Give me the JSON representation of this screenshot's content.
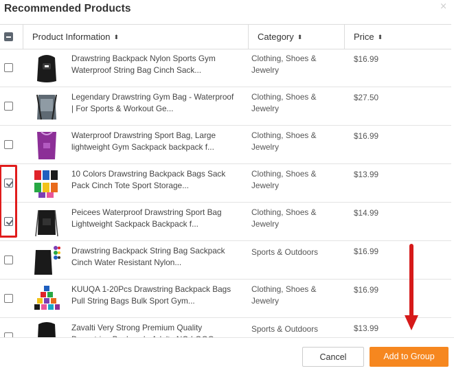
{
  "modal": {
    "title": "Recommended Products",
    "close_glyph": "×"
  },
  "table": {
    "columns": [
      {
        "label": "Product Information",
        "sort_glyph": "⬍"
      },
      {
        "label": "Category",
        "sort_glyph": "⬍"
      },
      {
        "label": "Price",
        "sort_glyph": "⬍"
      }
    ],
    "rows": [
      {
        "name": "Drawstring Backpack Nylon Sports Gym Waterproof String Bag Cinch Sack...",
        "category": "Clothing, Shoes & Jewelry",
        "price": "$16.99",
        "checked": false,
        "thumb": "black-backpack-icon"
      },
      {
        "name": "Legendary Drawstring Gym Bag - Waterproof | For Sports & Workout Ge...",
        "category": "Clothing, Shoes & Jewelry",
        "price": "$27.50",
        "checked": false,
        "thumb": "grey-gym-bag-icon"
      },
      {
        "name": "Waterproof Drawstring Sport Bag, Large lightweight Gym Sackpack backpack f...",
        "category": "Clothing, Shoes & Jewelry",
        "price": "$16.99",
        "checked": false,
        "thumb": "purple-drawstring-bag-icon"
      },
      {
        "name": "10 Colors Drawstring Backpack Bags Sack Pack Cinch Tote Sport Storage...",
        "category": "Clothing, Shoes & Jewelry",
        "price": "$13.99",
        "checked": true,
        "thumb": "multicolor-bags-icon"
      },
      {
        "name": "Peicees Waterproof Drawstring Sport Bag Lightweight Sackpack Backpack f...",
        "category": "Clothing, Shoes & Jewelry",
        "price": "$14.99",
        "checked": true,
        "thumb": "black-sackpack-icon"
      },
      {
        "name": "Drawstring Backpack String Bag Sackpack Cinch Water Resistant Nylon...",
        "category": "Sports & Outdoors",
        "price": "$16.99",
        "checked": false,
        "thumb": "black-bag-with-swatches-icon"
      },
      {
        "name": "KUUQA 1-20Pcs Drawstring Backpack Bags Pull String Bags Bulk Sport Gym...",
        "category": "Clothing, Shoes & Jewelry",
        "price": "$16.99",
        "checked": false,
        "thumb": "bulk-colored-bags-icon"
      },
      {
        "name": "Zavalti Very Strong Premium Quality Drawstring Backpack, Adults NO LOGO",
        "category": "Sports & Outdoors",
        "price": "$13.99",
        "checked": false,
        "thumb": "black-premium-bag-icon"
      }
    ]
  },
  "footer": {
    "cancel_label": "Cancel",
    "add_label": "Add to Group"
  },
  "colors": {
    "accent": "#f6871f",
    "annotation": "#e01b1b",
    "checkbox": "#5d6670"
  }
}
